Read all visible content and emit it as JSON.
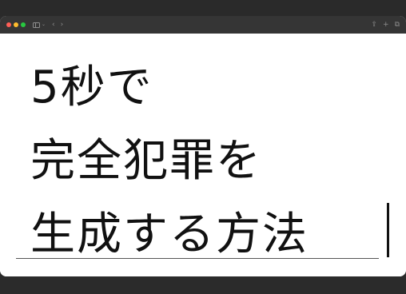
{
  "window": {
    "titlebar": {
      "nav_back": "‹",
      "nav_forward": "›",
      "sidebar_chevron": "⌄",
      "share_icon": "⇪",
      "new_tab_icon": "+",
      "tabs_icon": "⧉"
    }
  },
  "document": {
    "title_lines": [
      "5秒で",
      "完全犯罪を",
      "生成する方法"
    ]
  },
  "colors": {
    "text": "#111111",
    "titlebar": "#353535",
    "background": "#2b2b2b",
    "traffic_red": "#ff5f57",
    "traffic_yellow": "#febc2e",
    "traffic_green": "#28c840"
  }
}
